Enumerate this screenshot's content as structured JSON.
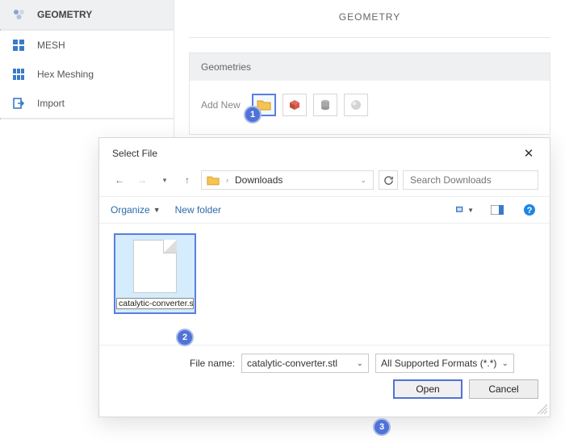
{
  "sidebar": {
    "items": [
      {
        "label": "GEOMETRY",
        "icon": "geometry-icon",
        "active": true
      },
      {
        "label": "MESH",
        "icon": "mesh-icon"
      },
      {
        "label": "Hex Meshing",
        "icon": "hex-icon"
      },
      {
        "label": "Import",
        "icon": "import-icon"
      }
    ]
  },
  "main": {
    "title": "GEOMETRY",
    "panel": {
      "header": "Geometries",
      "add_new_label": "Add New"
    }
  },
  "callouts": {
    "one": "1",
    "two": "2",
    "three": "3"
  },
  "dialog": {
    "title": "Select File",
    "path_segment": "Downloads",
    "search_placeholder": "Search Downloads",
    "organize_label": "Organize",
    "new_folder_label": "New folder",
    "file_name": "catalytic-converter.stl",
    "file_name_label": "File name:",
    "filename_value": "catalytic-converter.stl",
    "filter_value": "All Supported Formats (*.*)",
    "open_label": "Open",
    "cancel_label": "Cancel"
  }
}
